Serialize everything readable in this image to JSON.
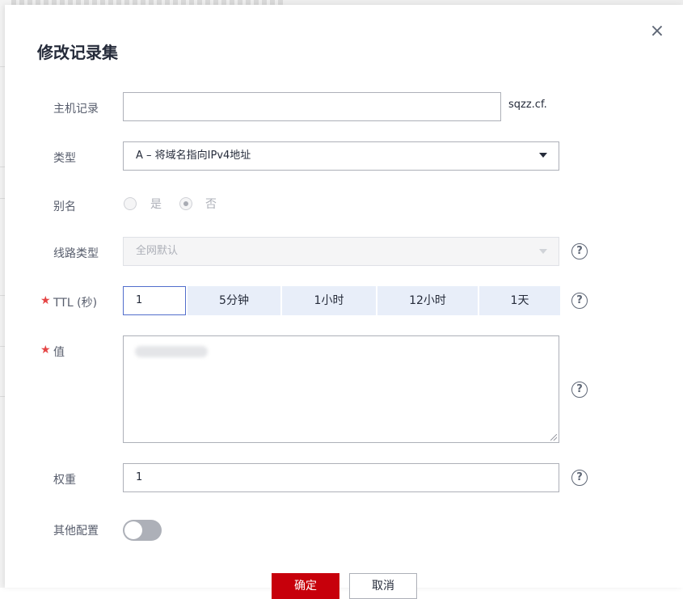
{
  "dialog": {
    "title": "修改记录集",
    "close_icon": "×"
  },
  "host_record": {
    "label": "主机记录",
    "value": "",
    "suffix": "sqzz.cf."
  },
  "type": {
    "label": "类型",
    "selected": "A – 将域名指向IPv4地址"
  },
  "alias": {
    "label": "别名",
    "options": [
      "是",
      "否"
    ],
    "selected": "否"
  },
  "line_type": {
    "label": "线路类型",
    "selected": "全网默认"
  },
  "ttl": {
    "required": "★",
    "label": "TTL (秒)",
    "value": "1",
    "presets": [
      "5分钟",
      "1小时",
      "12小时",
      "1天"
    ]
  },
  "value": {
    "required": "★",
    "label": "值"
  },
  "weight": {
    "label": "权重",
    "value": "1"
  },
  "other_config": {
    "label": "其他配置",
    "enabled": false
  },
  "footer": {
    "ok_label": "确定",
    "cancel_label": "取消"
  },
  "icons": {
    "help": "?"
  },
  "colors": {
    "primary_button": "#c7000b",
    "required_star": "#e54545",
    "ttl_preset_bg": "#e8eef9"
  }
}
